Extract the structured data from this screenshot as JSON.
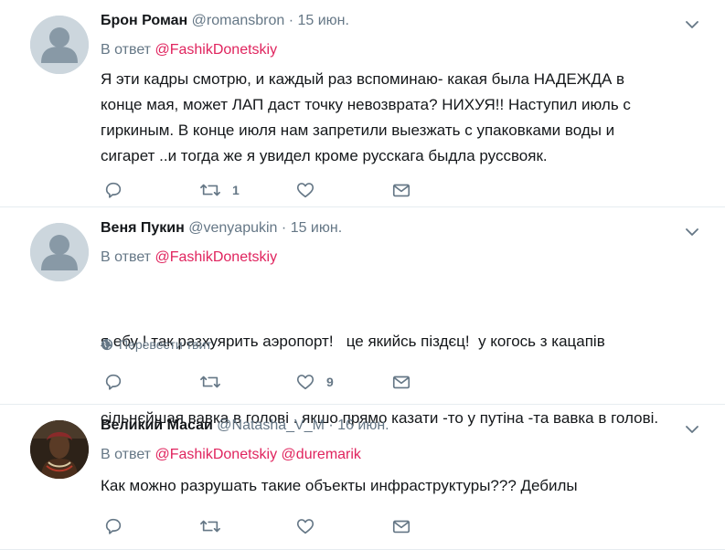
{
  "tweets": [
    {
      "name": "Брон Роман",
      "handle": "@romansbron",
      "separator": "·",
      "time": "15 июн.",
      "reply_prefix": "В ответ",
      "mentions": [
        "@FashikDonetskiy"
      ],
      "lines": [
        "Я эти кадры смотрю, и каждый раз вспоминаю- какая была НАДЕЖДА в",
        "конце мая, может ЛАП даст точку невозврата? НИХУЯ!! Наступил июль с",
        "гиркиным. В конце июля нам запретили выезжать с упаковками воды и",
        "сигарет ..и тогда же я увидел кроме русскага быдла руссвояк."
      ],
      "retweet_count": "1",
      "like_count": ""
    },
    {
      "name": "Веня Пукин",
      "handle": "@venyapukin",
      "separator": "·",
      "time": "15 июн.",
      "reply_prefix": "В ответ",
      "mentions": [
        "@FashikDonetskiy"
      ],
      "lines": [
        "я ебу ! так разхуярить аэропорт!   це якийсь піздєц!  у когось з кацапів",
        "сільнєйшая вавка в голові . якшо прямо казати -то у путіна -та вавка в голові."
      ],
      "translate_label": "Перевести твит",
      "retweet_count": "",
      "like_count": "9"
    },
    {
      "name": "Великий Масаи",
      "handle": "@Natasha_V_M",
      "separator": "·",
      "time": "16 июн.",
      "reply_prefix": "В ответ",
      "mentions": [
        "@FashikDonetskiy",
        "@duremarik"
      ],
      "lines": [
        "Как можно разрушать такие объекты инфраструктуры??? Дебилы"
      ],
      "retweet_count": "",
      "like_count": ""
    }
  ],
  "icons": {
    "reply": "reply-icon",
    "retweet": "retweet-icon",
    "like": "heart-icon",
    "dm": "envelope-icon",
    "more": "chevron-down-icon",
    "translate": "globe-icon"
  },
  "colors": {
    "mention": "#e0245e",
    "secondary_text": "#657786",
    "divider": "#e6ecf0",
    "default_avatar": "#ccd6dd"
  }
}
